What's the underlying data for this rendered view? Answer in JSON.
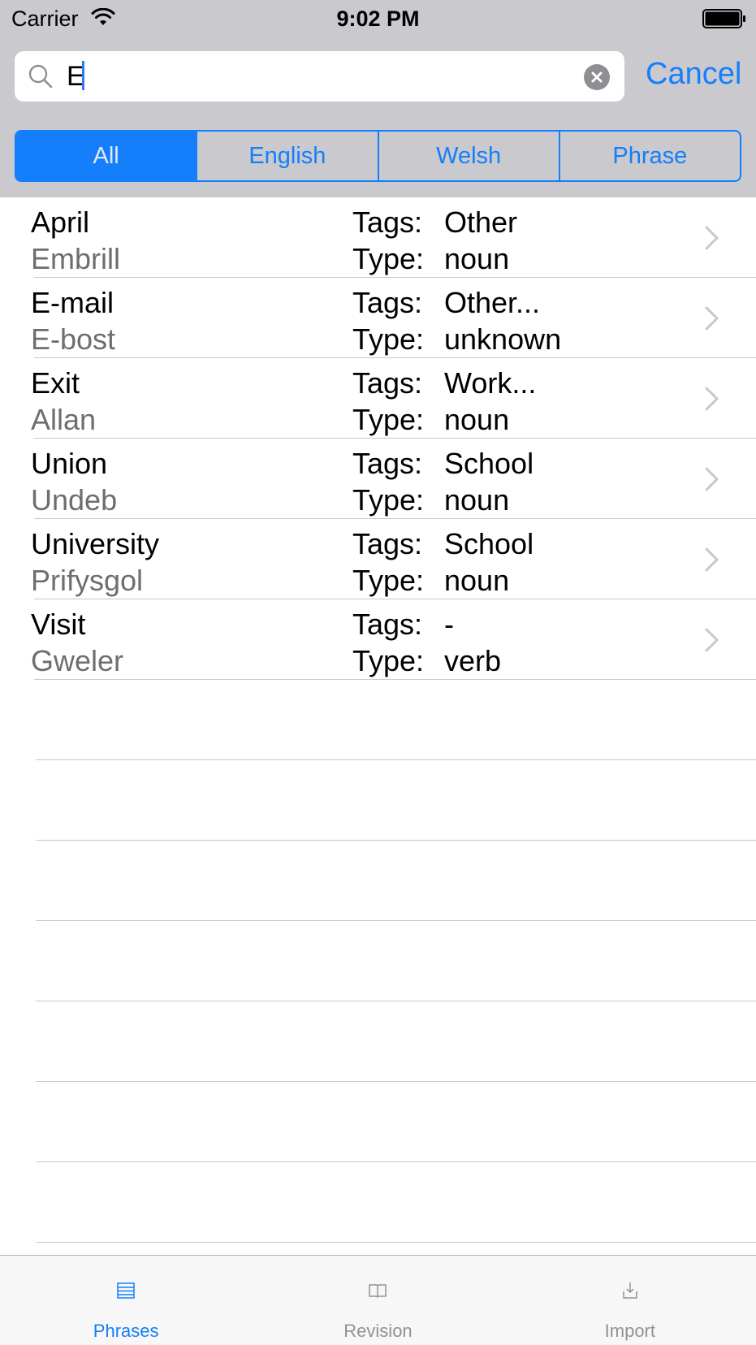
{
  "status_bar": {
    "carrier": "Carrier",
    "time": "9:02 PM"
  },
  "search": {
    "query": "E",
    "cancel_label": "Cancel"
  },
  "segments": [
    {
      "label": "All",
      "selected": true
    },
    {
      "label": "English",
      "selected": false
    },
    {
      "label": "Welsh",
      "selected": false
    },
    {
      "label": "Phrase",
      "selected": false
    }
  ],
  "list": {
    "tags_label": "Tags:",
    "type_label": "Type:",
    "rows": [
      {
        "english": "April",
        "welsh": "Embrill",
        "tags": "Other",
        "type": "noun"
      },
      {
        "english": "E-mail",
        "welsh": "E-bost",
        "tags": "Other...",
        "type": "unknown"
      },
      {
        "english": "Exit",
        "welsh": "Allan",
        "tags": "Work...",
        "type": "noun"
      },
      {
        "english": "Union",
        "welsh": "Undeb",
        "tags": "School",
        "type": "noun"
      },
      {
        "english": "University",
        "welsh": "Prifysgol",
        "tags": "School",
        "type": "noun"
      },
      {
        "english": "Visit",
        "welsh": "Gweler",
        "tags": "-",
        "type": "verb"
      }
    ]
  },
  "tab_bar": {
    "tabs": [
      {
        "label": "Phrases",
        "icon": "list-icon",
        "active": true
      },
      {
        "label": "Revision",
        "icon": "book-icon",
        "active": false
      },
      {
        "label": "Import",
        "icon": "import-icon",
        "active": false
      }
    ]
  },
  "colors": {
    "accent": "#147efb",
    "header_bg": "#c9c9ce",
    "secondary_text": "#6d6d72"
  }
}
